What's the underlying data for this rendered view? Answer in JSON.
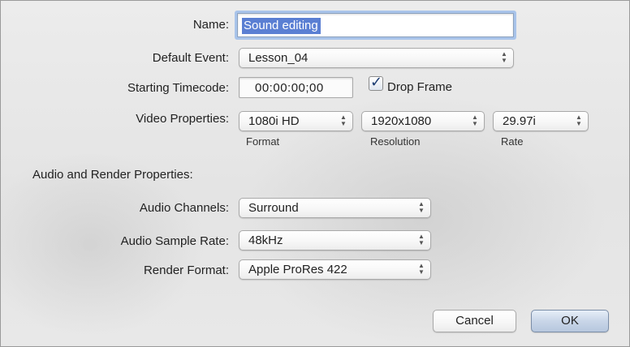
{
  "form": {
    "name_label": "Name:",
    "name_value": "Sound editing",
    "event_label": "Default Event:",
    "event_value": "Lesson_04",
    "timecode_label": "Starting Timecode:",
    "timecode_value": "00:00:00;00",
    "drop_frame_label": "Drop Frame",
    "drop_frame_checked": true,
    "video_label": "Video Properties:",
    "video_format": "1080i HD",
    "video_format_caption": "Format",
    "video_resolution": "1920x1080",
    "video_resolution_caption": "Resolution",
    "video_rate": "29.97i",
    "video_rate_caption": "Rate",
    "section_title": "Audio and Render Properties:",
    "audio_channels_label": "Audio Channels:",
    "audio_channels_value": "Surround",
    "sample_rate_label": "Audio Sample Rate:",
    "sample_rate_value": "48kHz",
    "render_format_label": "Render Format:",
    "render_format_value": "Apple ProRes 422"
  },
  "buttons": {
    "cancel": "Cancel",
    "ok": "OK"
  },
  "icons": {
    "popup_arrows": "updown-chevrons-icon",
    "checkbox_tick": "checkmark-icon"
  },
  "colors": {
    "selection": "#5a7fd3",
    "focus_ring": "#a9c4ea",
    "default_button": "#c9d6e8"
  }
}
